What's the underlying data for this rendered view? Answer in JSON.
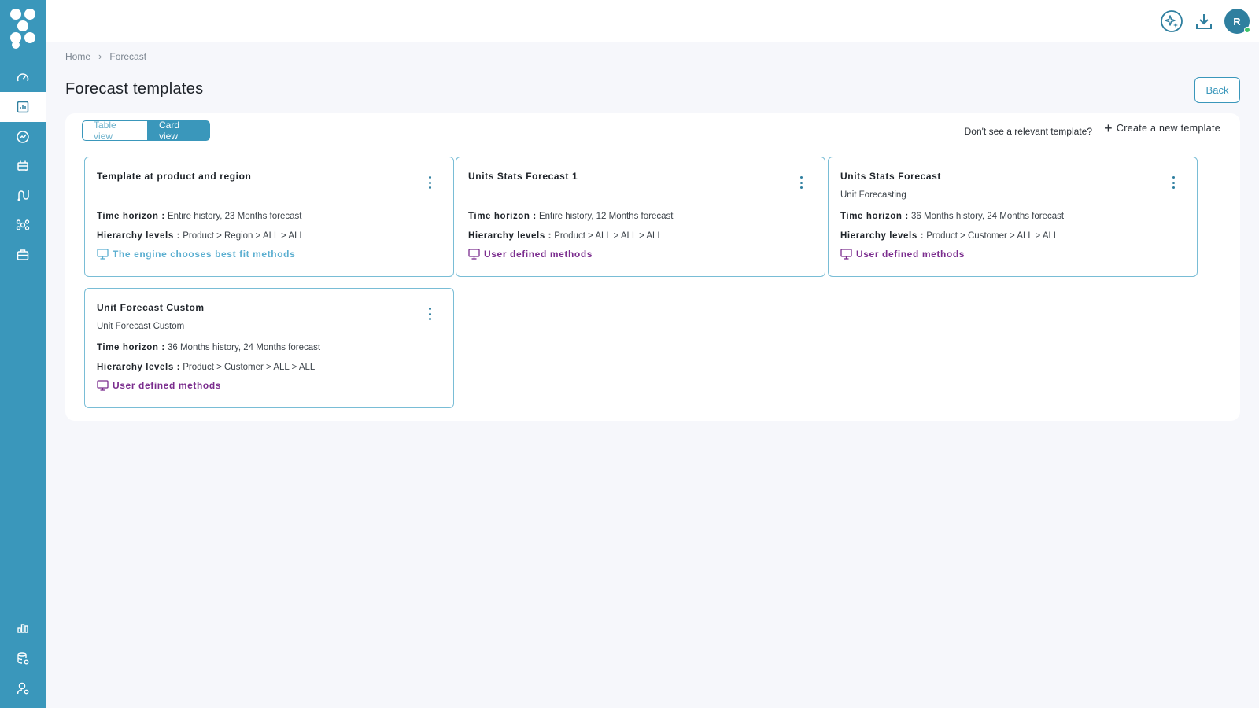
{
  "brand": {
    "sidebar_color": "#3a97bb",
    "accent": "#3a97bb",
    "method_user_color": "#7b2d8e",
    "method_engine_color": "#5aaed0"
  },
  "sidebar": {
    "items": [
      {
        "icon": "speedometer-icon"
      },
      {
        "icon": "chart-report-icon",
        "active": true
      },
      {
        "icon": "trend-circle-icon"
      },
      {
        "icon": "stack-box-icon"
      },
      {
        "icon": "route-icon"
      },
      {
        "icon": "nodes-icon"
      },
      {
        "icon": "briefcase-icon"
      }
    ],
    "bottom_items": [
      {
        "icon": "bar-chart-icon"
      },
      {
        "icon": "database-settings-icon"
      },
      {
        "icon": "user-settings-icon"
      }
    ]
  },
  "topbar": {
    "icons": [
      "ai-sparkle-icon",
      "download-icon"
    ],
    "avatar_initial": "R"
  },
  "breadcrumb": {
    "items": [
      "Home",
      "Forecast"
    ]
  },
  "page": {
    "title": "Forecast templates",
    "back_label": "Back"
  },
  "toolbar": {
    "views": [
      "Table view",
      "Card view"
    ],
    "active_view": "Card view",
    "prompt": "Don't see a relevant template?",
    "create_label": "Create a new template"
  },
  "labels": {
    "time_horizon": "Time horizon :",
    "hierarchy_levels": "Hierarchy levels :"
  },
  "cards": [
    {
      "title": "Template at product and region",
      "subtitle": "",
      "time_horizon": "Entire history, 23 Months forecast",
      "hierarchy": "Product > Region > ALL > ALL",
      "method": "The engine chooses best fit methods",
      "method_type": "engine"
    },
    {
      "title": "Units Stats Forecast 1",
      "subtitle": "",
      "time_horizon": "Entire history, 12 Months forecast",
      "hierarchy": "Product > ALL > ALL > ALL",
      "method": "User defined methods",
      "method_type": "user"
    },
    {
      "title": "Units Stats Forecast",
      "subtitle": "Unit Forecasting",
      "time_horizon": "36 Months history, 24 Months forecast",
      "hierarchy": "Product > Customer > ALL > ALL",
      "method": "User defined methods",
      "method_type": "user"
    },
    {
      "title": "Unit Forecast Custom",
      "subtitle": "Unit Forecast Custom",
      "time_horizon": "36 Months history, 24 Months forecast",
      "hierarchy": "Product > Customer > ALL > ALL",
      "method": "User defined methods",
      "method_type": "user"
    }
  ]
}
